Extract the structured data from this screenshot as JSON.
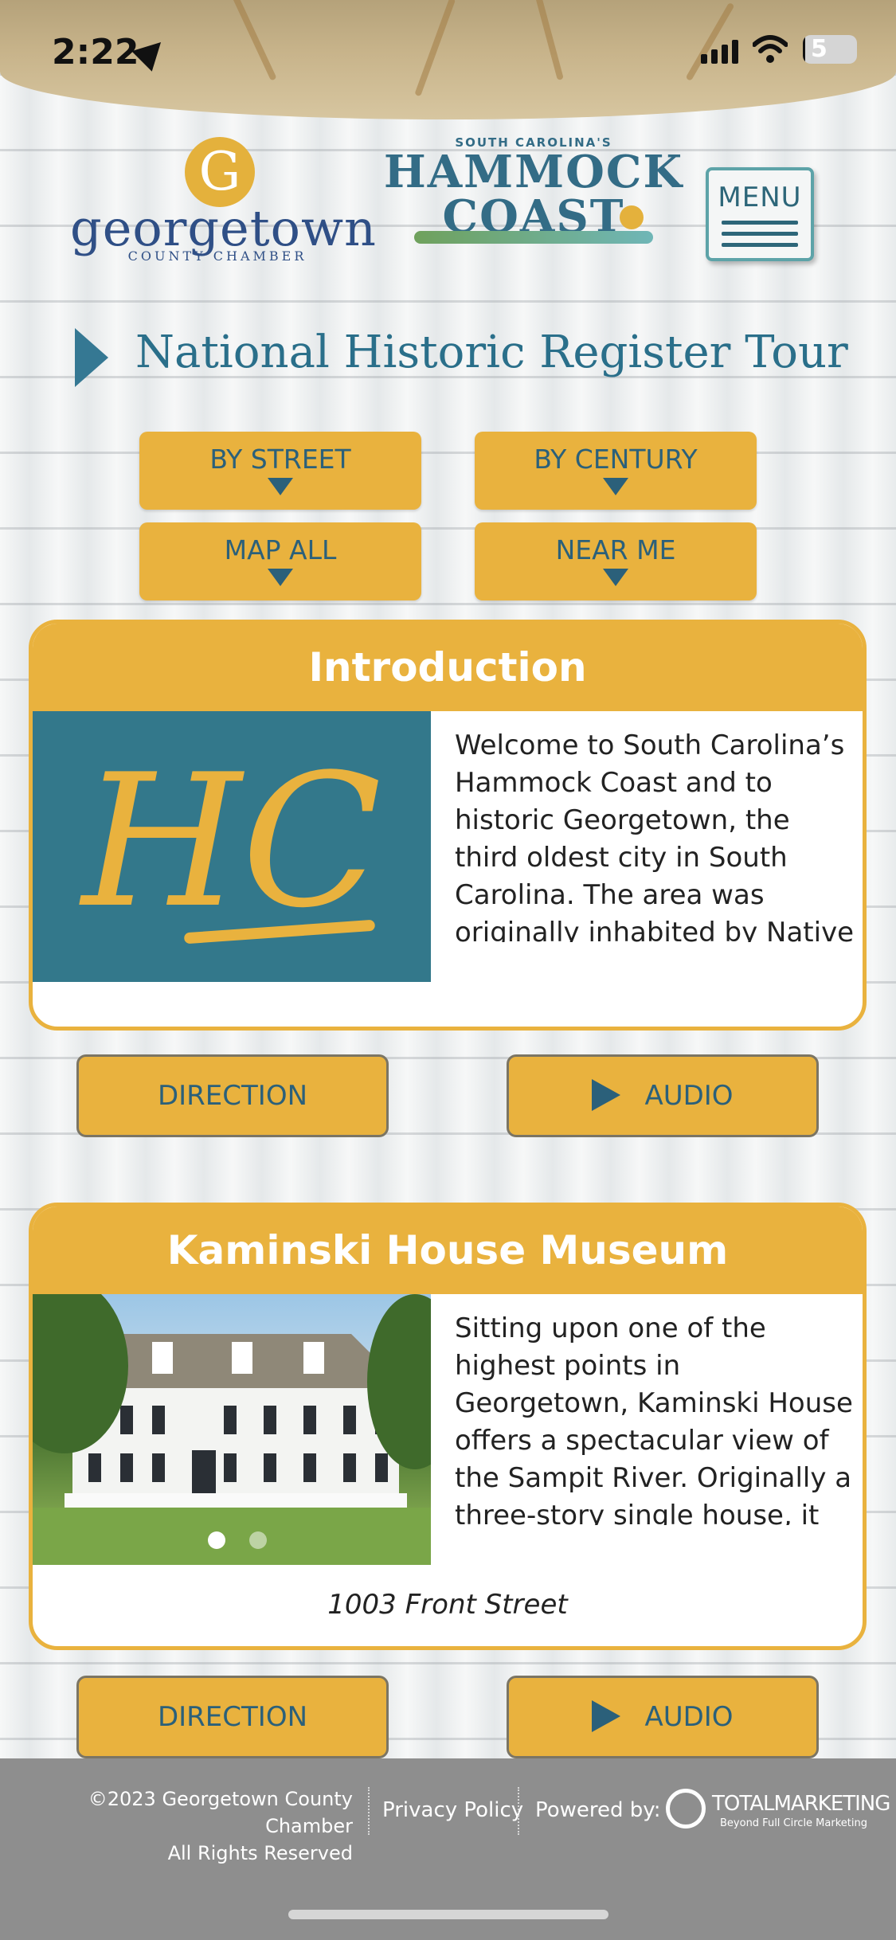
{
  "status_bar": {
    "time": "2:22",
    "battery": "5",
    "battery_level": 0.05
  },
  "header": {
    "chamber_logo": {
      "letter": "G",
      "word": "georgetown",
      "sub": "COUNTY CHAMBER"
    },
    "hammock_logo": {
      "small": "SOUTH CAROLINA'S",
      "line1": "HAMMOCK",
      "line2": "COAST"
    },
    "menu_label": "MENU"
  },
  "page": {
    "title": "National Historic Register Tour"
  },
  "filters": [
    {
      "label": "BY STREET"
    },
    {
      "label": "BY CENTURY"
    },
    {
      "label": "MAP ALL"
    },
    {
      "label": "NEAR ME"
    }
  ],
  "cards": [
    {
      "title": "Introduction",
      "image_letters": "HC",
      "description": "Welcome to South Carolina’s Hammock Coast and to historic Georgetown, the third oldest city in South Carolina. The area was originally inhabited by Native Americans of the",
      "address": "",
      "direction_label": "DIRECTION",
      "audio_label": "AUDIO"
    },
    {
      "title": "Kaminski House Museum",
      "image_letters": "",
      "description": "Sitting upon one of the highest points in Georgetown, Kaminski House offers a spectacular view of the Sampit River. Originally a three-story single house, it has been",
      "address": "1003 Front Street",
      "direction_label": "DIRECTION",
      "audio_label": "AUDIO"
    }
  ],
  "footer": {
    "copyright_line1": "©2023 Georgetown County Chamber",
    "copyright_line2": "All Rights Reserved",
    "privacy": "Privacy Policy",
    "powered_by": "Powered by:",
    "brand": "TOTALMARKETING",
    "brand_tagline": "Beyond Full Circle Marketing"
  },
  "colors": {
    "gold": "#e9b23e",
    "teal": "#2b607a",
    "footer": "#8e8e8e"
  }
}
